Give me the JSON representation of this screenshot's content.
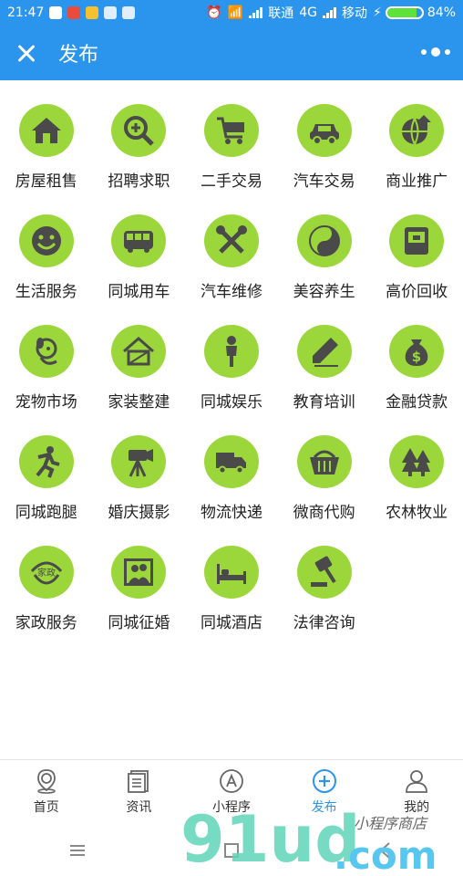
{
  "status": {
    "time": "21:47",
    "carrier1": "联通",
    "net": "4G",
    "carrier2": "移动",
    "battery": "84%",
    "battery_level": 0.84
  },
  "header": {
    "title": "发布"
  },
  "categories": [
    {
      "label": "房屋租售",
      "icon": "house-icon"
    },
    {
      "label": "招聘求职",
      "icon": "magnifier-plus-icon"
    },
    {
      "label": "二手交易",
      "icon": "shopping-cart-icon"
    },
    {
      "label": "汽车交易",
      "icon": "car-icon"
    },
    {
      "label": "商业推广",
      "icon": "globe-arrow-icon"
    },
    {
      "label": "生活服务",
      "icon": "smiley-icon"
    },
    {
      "label": "同城用车",
      "icon": "bus-icon"
    },
    {
      "label": "汽车维修",
      "icon": "tools-icon"
    },
    {
      "label": "美容养生",
      "icon": "yin-yang-icon"
    },
    {
      "label": "高价回收",
      "icon": "device-icon"
    },
    {
      "label": "宠物市场",
      "icon": "dog-icon"
    },
    {
      "label": "家装整建",
      "icon": "house-build-icon"
    },
    {
      "label": "同城娱乐",
      "icon": "person-icon"
    },
    {
      "label": "教育培训",
      "icon": "pen-icon"
    },
    {
      "label": "金融贷款",
      "icon": "money-bag-icon"
    },
    {
      "label": "同城跑腿",
      "icon": "runner-icon"
    },
    {
      "label": "婚庆摄影",
      "icon": "camera-tripod-icon"
    },
    {
      "label": "物流快递",
      "icon": "truck-icon"
    },
    {
      "label": "微商代购",
      "icon": "basket-icon"
    },
    {
      "label": "农林牧业",
      "icon": "trees-icon"
    },
    {
      "label": "家政服务",
      "icon": "housekeeping-icon",
      "badge": "家政"
    },
    {
      "label": "同城征婚",
      "icon": "couple-photo-icon"
    },
    {
      "label": "同城酒店",
      "icon": "bed-icon"
    },
    {
      "label": "法律咨询",
      "icon": "gavel-icon"
    }
  ],
  "nav": [
    {
      "label": "首页",
      "icon": "map-pin-icon"
    },
    {
      "label": "资讯",
      "icon": "news-icon"
    },
    {
      "label": "小程序",
      "icon": "mini-program-icon"
    },
    {
      "label": "发布",
      "icon": "plus-circle-icon",
      "active": true
    },
    {
      "label": "我的",
      "icon": "user-icon"
    }
  ],
  "watermark": {
    "brand": "91ud",
    "domain": ".com",
    "tagline": "小程序商店"
  },
  "colors": {
    "primary": "#2b95ee",
    "icon_bg": "#9bd73b",
    "icon_fg": "#4a4a4a"
  }
}
